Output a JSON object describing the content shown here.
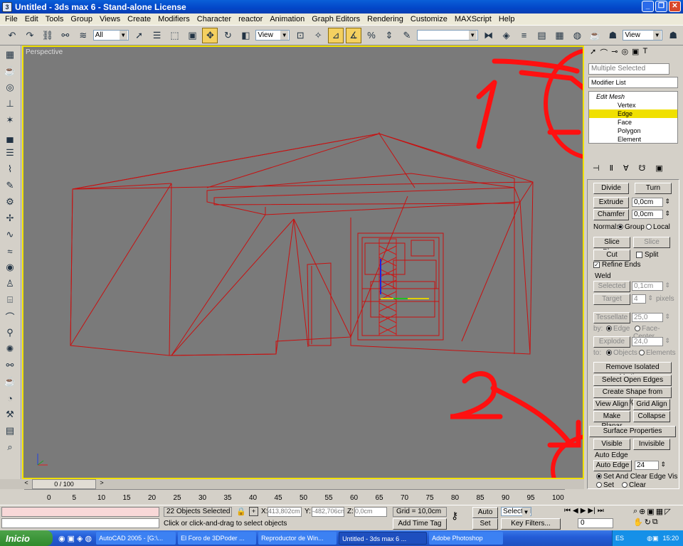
{
  "window": {
    "title": "Untitled - 3ds max 6 - Stand-alone License",
    "app_icon": "3ds-max-icon"
  },
  "menu": [
    "File",
    "Edit",
    "Tools",
    "Group",
    "Views",
    "Create",
    "Modifiers",
    "Character",
    "reactor",
    "Animation",
    "Graph Editors",
    "Rendering",
    "Customize",
    "MAXScript",
    "Help"
  ],
  "toolbar": {
    "selection_filter": "All",
    "ref_coord": "View",
    "named_sel": "",
    "view_right": "View"
  },
  "viewport": {
    "label": "Perspective"
  },
  "annotations": {
    "one": "1",
    "two": "2"
  },
  "panel": {
    "object_name": "Multiple Selected",
    "modifier_list": "Modifier List",
    "stack": {
      "root": "Edit Mesh",
      "items": [
        "Vertex",
        "Edge",
        "Face",
        "Polygon",
        "Element"
      ],
      "selected": "Edge"
    },
    "buttons": {
      "divide": "Divide",
      "turn": "Turn",
      "extrude": "Extrude",
      "extrude_val": "0,0cm",
      "chamfer": "Chamfer",
      "chamfer_val": "0,0cm",
      "normal": "Normal:",
      "group": "Group",
      "local": "Local",
      "slice_plane": "Slice Plane",
      "slice": "Slice",
      "cut": "Cut",
      "split": "Split",
      "refine_ends": "Refine Ends",
      "weld": "Weld",
      "selected": "Selected",
      "weld_val": "0,1cm",
      "target": "Target",
      "target_val": "4",
      "pixels": "pixels",
      "tessellate": "Tessellate",
      "tess_val": "25,0",
      "by": "by:",
      "edge": "Edge",
      "face_center": "Face-Center",
      "explode": "Explode",
      "explode_val": "24,0",
      "to": "to:",
      "objects": "Objects",
      "elements": "Elements",
      "remove_isolated": "Remove Isolated Vertices",
      "select_open": "Select Open Edges",
      "create_shape": "Create Shape from Edges",
      "view_align": "View Align",
      "grid_align": "Grid Align",
      "make_planar": "Make Planar",
      "collapse": "Collapse",
      "surface_props": "Surface Properties",
      "visible": "Visible",
      "invisible": "Invisible",
      "auto_edge_group": "Auto Edge",
      "auto_edge": "Auto Edge",
      "auto_edge_val": "24",
      "set_and_clear": "Set And Clear Edge Vis",
      "set": "Set",
      "clear": "Clear"
    }
  },
  "timeline": {
    "slider": "0 / 100",
    "ticks": [
      "0",
      "5",
      "10",
      "15",
      "20",
      "25",
      "30",
      "35",
      "40",
      "45",
      "50",
      "55",
      "60",
      "65",
      "70",
      "75",
      "80",
      "85",
      "90",
      "95",
      "100"
    ]
  },
  "status": {
    "objects_selected": "22 Objects Selected",
    "prompt": "Click or click-and-drag to select objects",
    "x_label": "X:",
    "x": "413,802cm",
    "y_label": "Y:",
    "y": "-482,706cn",
    "z_label": "Z:",
    "z": "0,0cm",
    "grid": "Grid = 10,0cm",
    "add_time_tag": "Add Time Tag",
    "auto_key": "Auto Key",
    "set_key": "Set Key",
    "key_mode": "Selected",
    "key_filters": "Key Filters...",
    "frame": "0"
  },
  "taskbar": {
    "start": "Inicio",
    "tasks": [
      "AutoCAD 2005 - [G:\\...",
      "El Foro de 3DPoder ...",
      "Reproductor de Win...",
      "Untitled - 3ds max 6 ...",
      "Adobe Photoshop"
    ],
    "active": 3,
    "lang": "ES",
    "clock": "15:20"
  }
}
